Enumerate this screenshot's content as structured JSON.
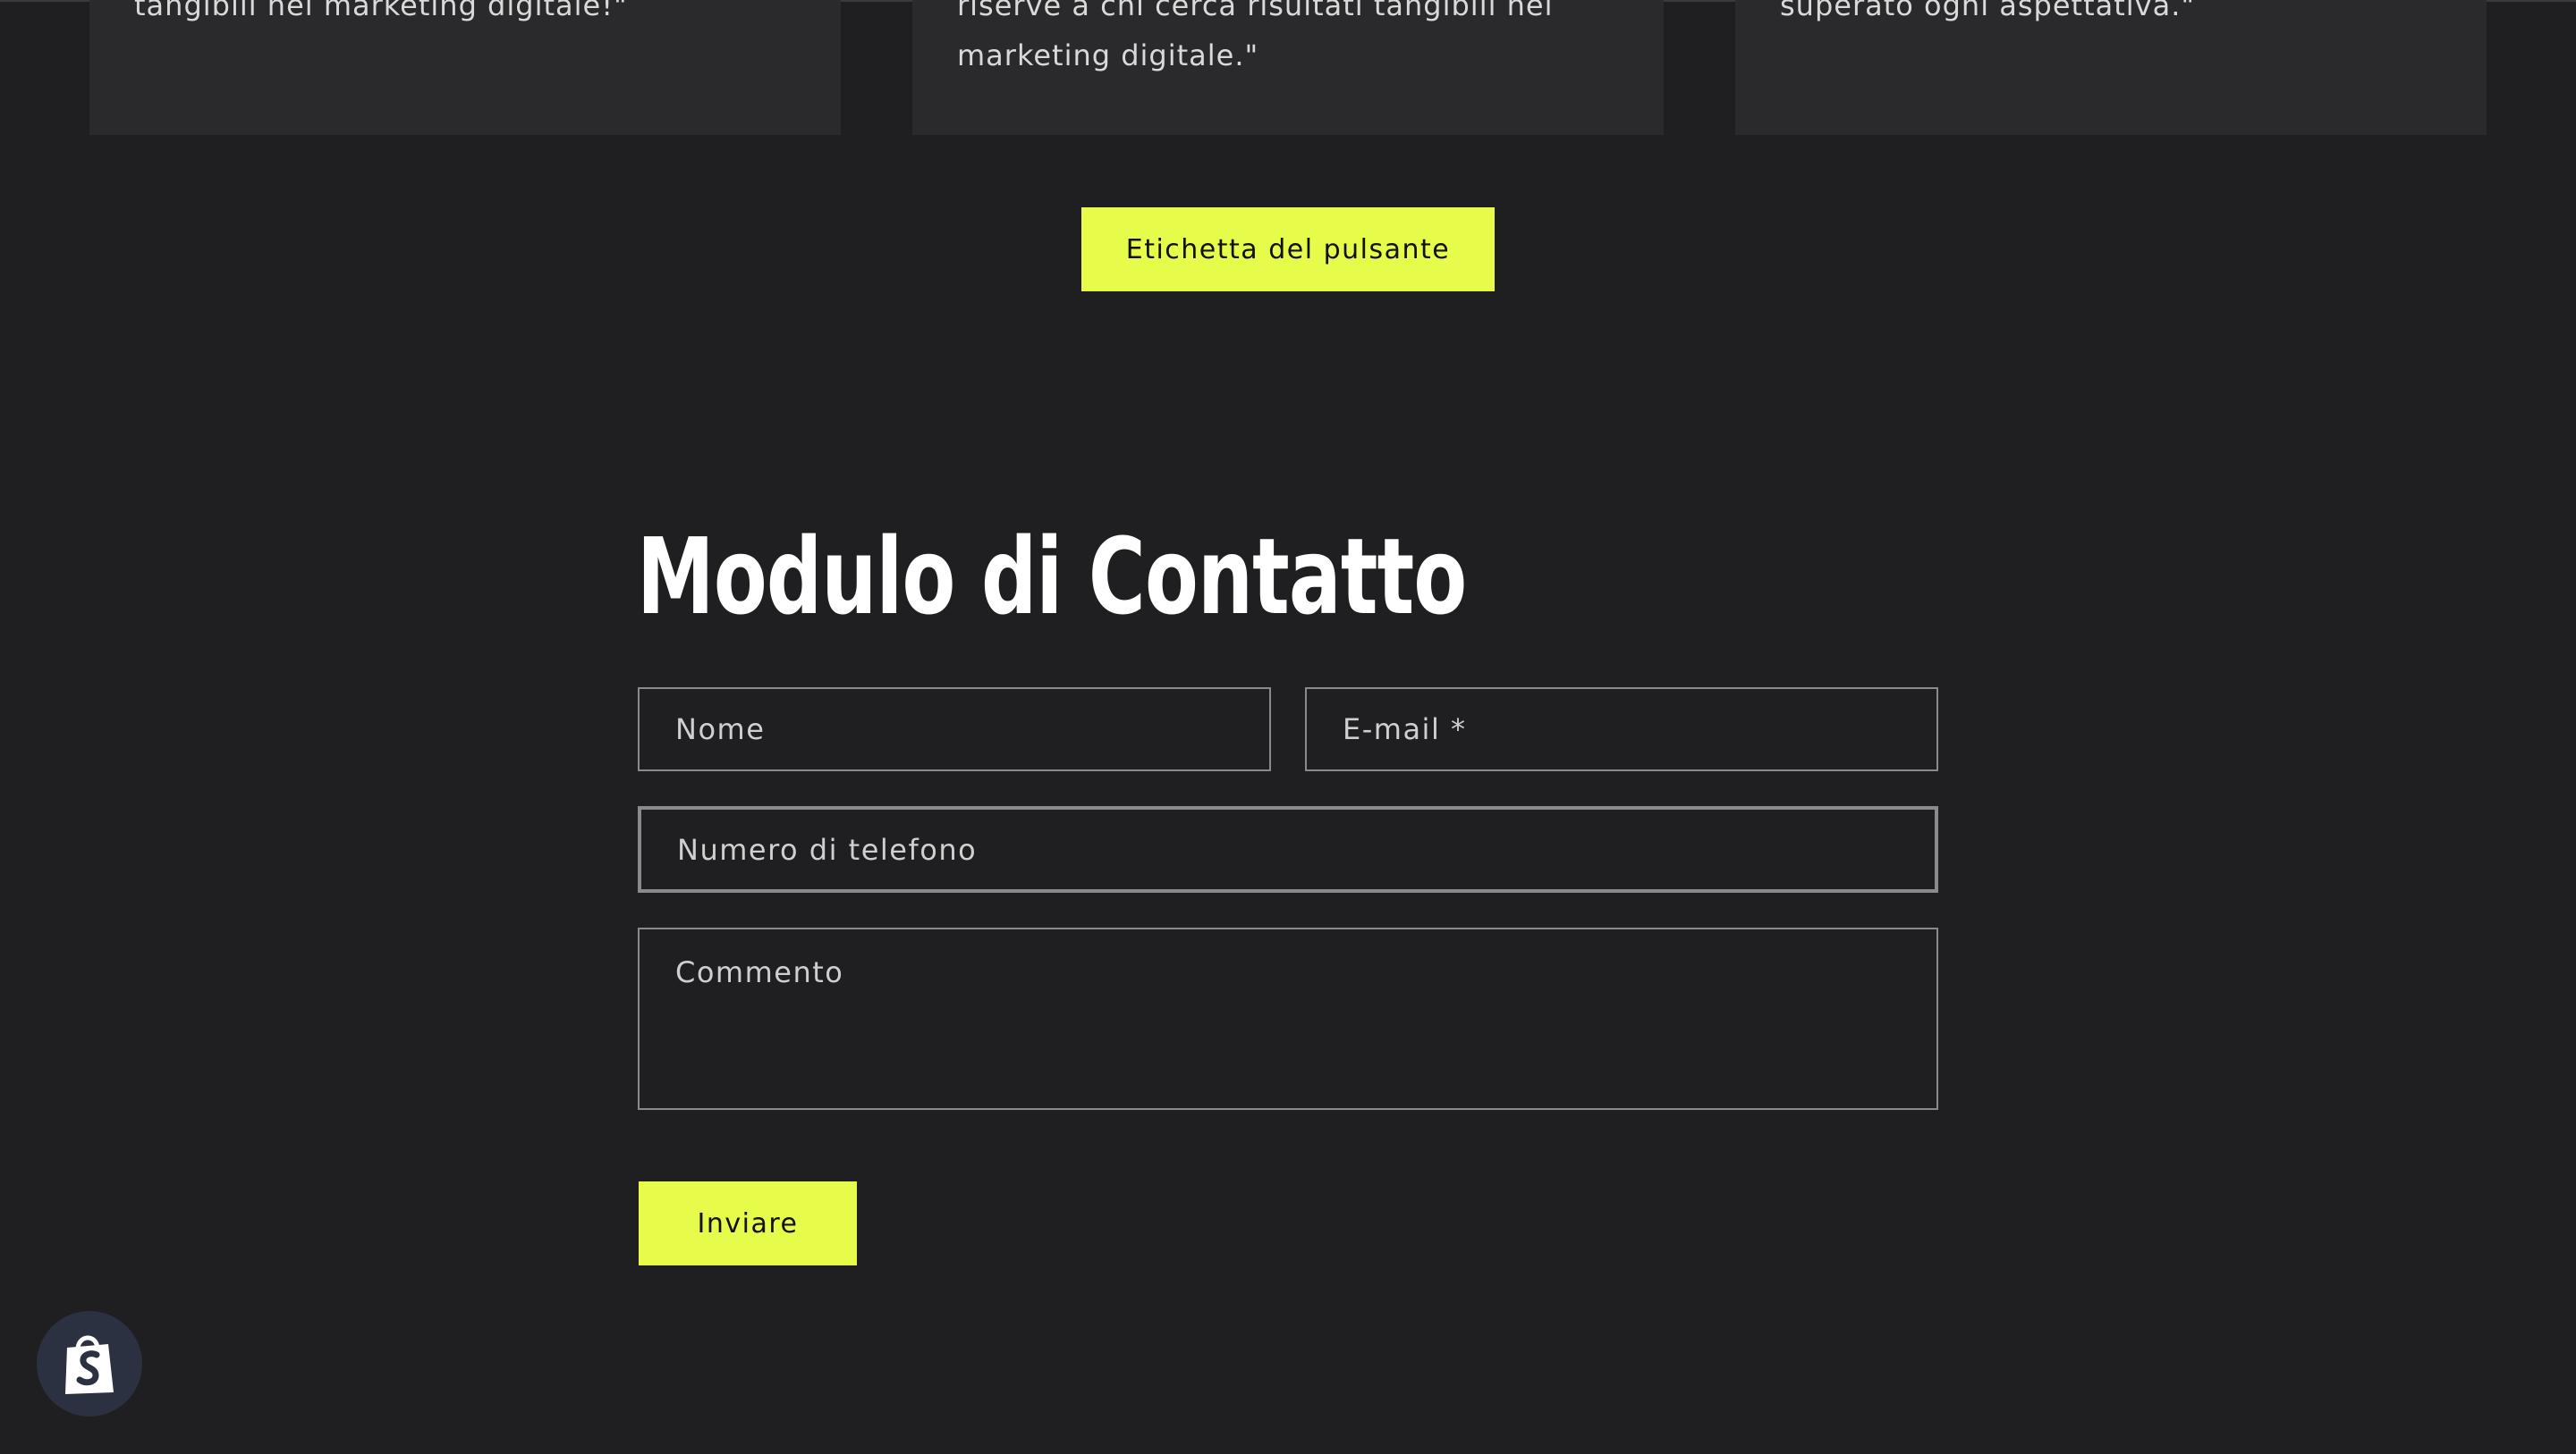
{
  "testimonials": [
    {
      "quote": "tangibili nel marketing digitale!\""
    },
    {
      "quote": "riserve a chi cerca risultati tangibili nel\nmarketing digitale.\""
    },
    {
      "quote": "superato ogni aspettativa.\""
    }
  ],
  "cta": {
    "label": "Etichetta del pulsante"
  },
  "contact_form": {
    "title": "Modulo di Contatto",
    "name_placeholder": "Nome",
    "email_placeholder": "E-mail *",
    "phone_placeholder": "Numero di telefono",
    "comment_placeholder": "Commento",
    "submit_label": "Inviare"
  },
  "colors": {
    "background": "#1f1f21",
    "card": "#2a2a2c",
    "accent": "#e6fb4a",
    "field_border": "#8a8a8c"
  },
  "badge": {
    "icon": "shopify-bag-icon"
  }
}
